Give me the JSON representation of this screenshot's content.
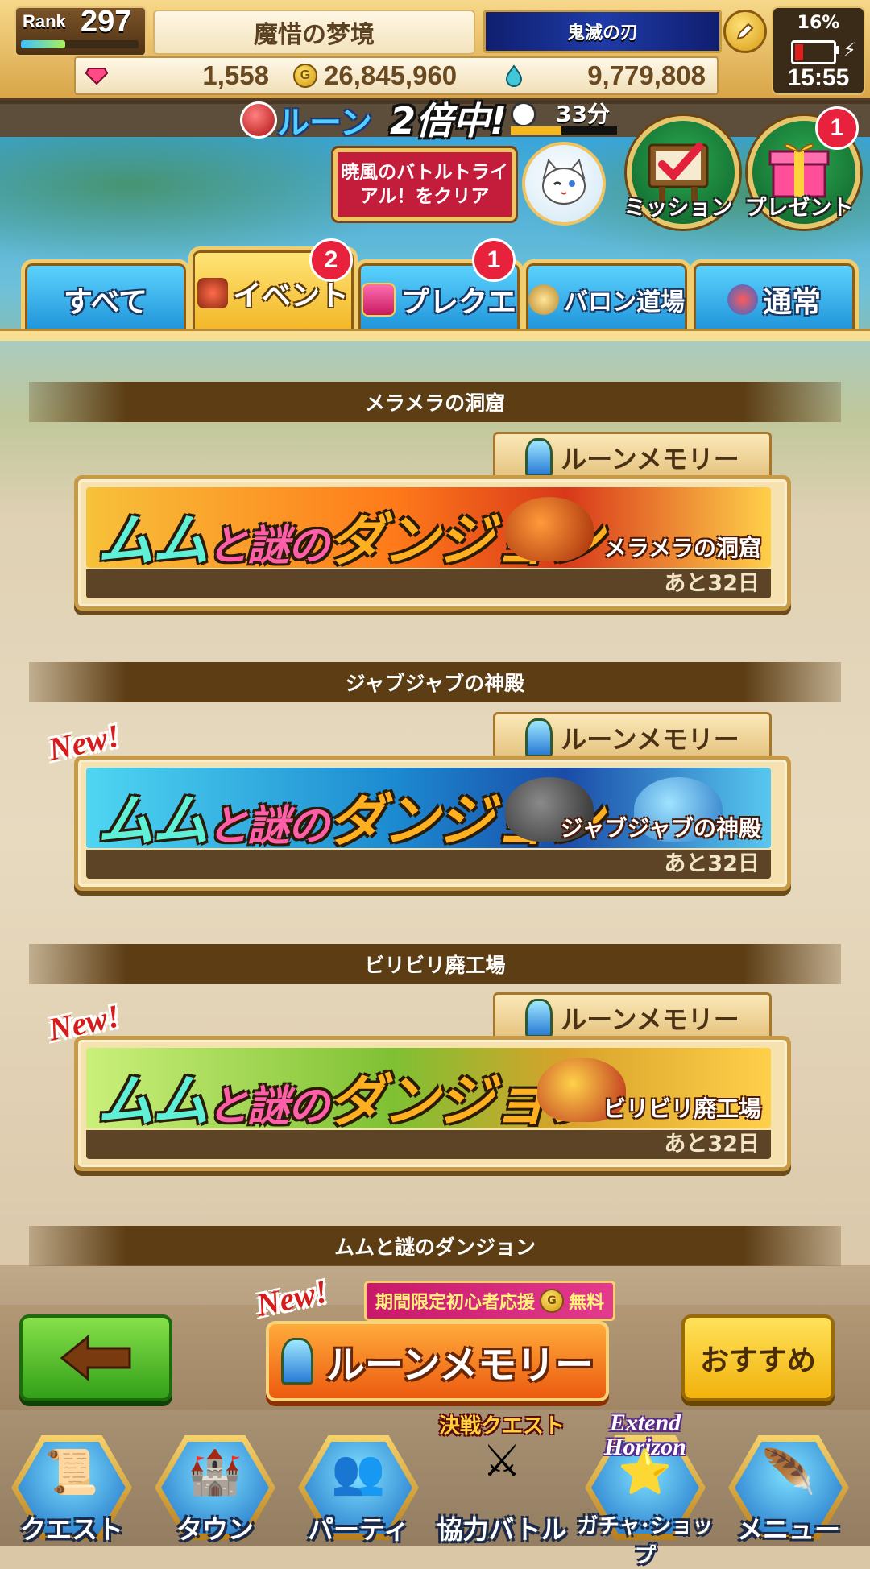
{
  "header": {
    "rank_label": "Rank",
    "rank_value": "297",
    "rank_progress": 0.38,
    "player_title": "魔惜の梦境",
    "guild_badge": "鬼滅の刃",
    "battery_percent": "16%",
    "clock": "15:55"
  },
  "currency": {
    "gems": "1,558",
    "gold": "26,845,960",
    "gold_icon": "G",
    "water": "9,779,808"
  },
  "rune_event": {
    "label": "ルーン",
    "multiplier": "2倍中!",
    "time_left": "33分",
    "time_progress": 0.48
  },
  "quick": {
    "clear_banner": "暁風のバトルトライアル！をクリア",
    "mission": "ミッション",
    "present": "プレゼント",
    "present_badge": "1"
  },
  "tabs": [
    {
      "label": "すべて",
      "badge": ""
    },
    {
      "label": "イベント",
      "badge": "2"
    },
    {
      "label": "プレクエ",
      "badge": "1"
    },
    {
      "label": "バロン道場",
      "badge": ""
    },
    {
      "label": "通常",
      "badge": ""
    }
  ],
  "quests": [
    {
      "section": "メラメラの洞窟",
      "tag": "ルーンメモリー",
      "logo": [
        "ムム",
        "と謎の",
        "ダンジョン"
      ],
      "subtitle": "メラメラの洞窟",
      "time_left": "あと32日",
      "new": "",
      "theme_color": "#e0551a"
    },
    {
      "section": "ジャブジャブの神殿",
      "tag": "ルーンメモリー",
      "logo": [
        "ムム",
        "と謎の",
        "ダンジョン"
      ],
      "subtitle": "ジャブジャブの神殿",
      "time_left": "あと32日",
      "new": "New!",
      "theme_color": "#1f86c8"
    },
    {
      "section": "ビリビリ廃工場",
      "tag": "ルーンメモリー",
      "logo": [
        "ムム",
        "と謎の",
        "ダンジョン"
      ],
      "subtitle": "ビリビリ廃工場",
      "time_left": "あと32日",
      "new": "New!",
      "theme_color": "#7fc033"
    },
    {
      "section": "ムムと謎のダンジョン"
    }
  ],
  "actions": {
    "promo_new": "New!",
    "promo_text_a": "期間限定初心者応援",
    "promo_coin": "G",
    "promo_text_b": "無料",
    "rune_memory_button": "ルーンメモリー",
    "recommend_button": "おすすめ"
  },
  "nav": [
    {
      "label": "クエスト",
      "icon": "quest-scroll-icon"
    },
    {
      "label": "タウン",
      "icon": "town-icon"
    },
    {
      "label": "パーティ",
      "icon": "party-icon"
    },
    {
      "label": "協力バトル",
      "icon": "coop-battle-icon",
      "extra": "決戦クエスト"
    },
    {
      "label": "ガチャ･ショップ",
      "icon": "gacha-shop-icon",
      "extra": "Extend Horizon"
    },
    {
      "label": "メニュー",
      "icon": "menu-scroll-icon"
    }
  ],
  "colors": {
    "tab_blue": "#1a8fd6",
    "tab_active": "#f2b421",
    "badge_red": "#e8213c",
    "back_green": "#33a018",
    "recommend_yellow": "#f2b20c",
    "rune_orange": "#ec5a0f"
  }
}
